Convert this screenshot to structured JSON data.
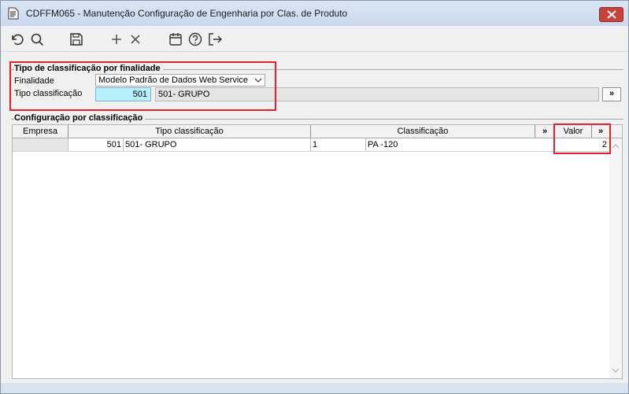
{
  "window": {
    "title": "CDFFM065 - Manutenção Configuração de Engenharia por Clas. de Produto",
    "icon": "document-icon"
  },
  "toolbar": {
    "items": [
      "undo-icon",
      "search-icon",
      "save-icon",
      "add-icon",
      "delete-icon",
      "calendar-icon",
      "help-icon",
      "exit-icon"
    ]
  },
  "filter_group": {
    "title": "Tipo de classificação por finalidade",
    "finalidade_label": "Finalidade",
    "finalidade_value": "Modelo Padrão de Dados Web Service",
    "tipo_label": "Tipo classificação",
    "tipo_code": "501",
    "tipo_desc": "501- GRUPO",
    "more_label": "»"
  },
  "grid_group": {
    "title": "Configuração por classificação",
    "columns": [
      "Empresa",
      "Tipo classificação",
      "Classificação",
      "»",
      "Valor",
      "»"
    ],
    "rows": [
      {
        "empresa": "",
        "tipo_code": "501",
        "tipo_desc": "501- GRUPO",
        "class_code": "1",
        "class_desc": "PA -120",
        "valor": "2"
      }
    ]
  },
  "colors": {
    "title_bar": "#c9d9ee",
    "close_button": "#c7423a",
    "input_active": "#b7f0fb",
    "highlight_box": "#e0212e"
  }
}
